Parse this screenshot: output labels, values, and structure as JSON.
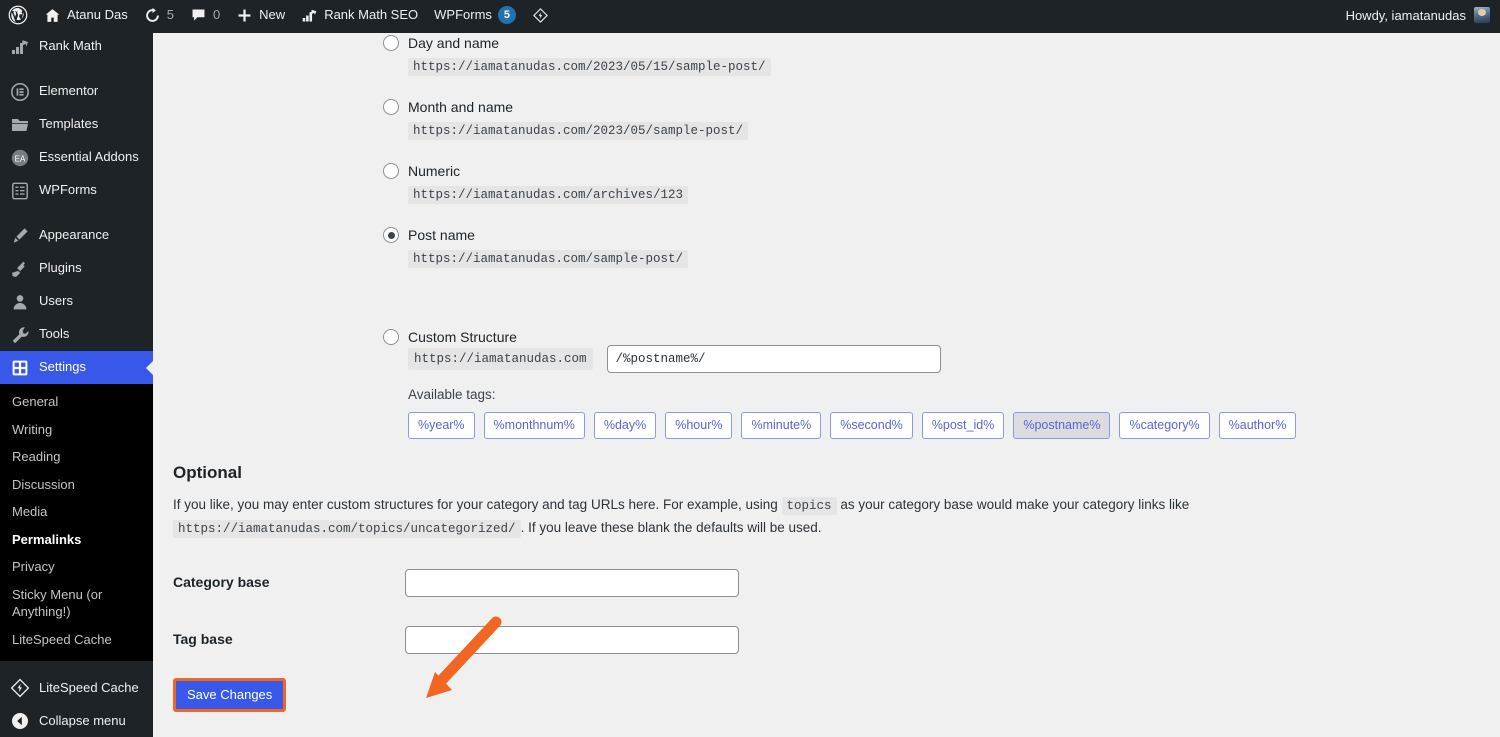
{
  "adminbar": {
    "logo_icon": "wordpress-logo-icon",
    "items": [
      {
        "icon": "home-icon",
        "label": "Atanu Das",
        "count": null
      },
      {
        "icon": "updates-icon",
        "label": "",
        "count": "5"
      },
      {
        "icon": "comment-icon",
        "label": "",
        "count": "0"
      },
      {
        "icon": "plus-icon",
        "label": "New",
        "count": null
      },
      {
        "icon": "rankmath-icon",
        "label": "Rank Math SEO",
        "count": null
      },
      {
        "icon": "wpforms-icon",
        "label": "WPForms",
        "badge": "5"
      },
      {
        "icon": "litespeed-icon",
        "label": "",
        "count": null
      }
    ],
    "howdy": "Howdy, iamatanudas"
  },
  "sidebar": {
    "menu": [
      {
        "label": "Rank Math",
        "icon": "rankmath-icon",
        "current": false,
        "gap_after": true
      },
      {
        "label": "Elementor",
        "icon": "elementor-icon",
        "current": false
      },
      {
        "label": "Templates",
        "icon": "folder-icon",
        "current": false
      },
      {
        "label": "Essential Addons",
        "icon": "essential-addons-icon",
        "current": false
      },
      {
        "label": "WPForms",
        "icon": "wpforms-icon",
        "current": false,
        "gap_after": true
      },
      {
        "label": "Appearance",
        "icon": "appearance-icon",
        "current": false
      },
      {
        "label": "Plugins",
        "icon": "plugins-icon",
        "current": false
      },
      {
        "label": "Users",
        "icon": "users-icon",
        "current": false
      },
      {
        "label": "Tools",
        "icon": "tools-icon",
        "current": false
      },
      {
        "label": "Settings",
        "icon": "settings-icon",
        "current": true
      }
    ],
    "submenu": [
      {
        "label": "General",
        "current": false
      },
      {
        "label": "Writing",
        "current": false
      },
      {
        "label": "Reading",
        "current": false
      },
      {
        "label": "Discussion",
        "current": false
      },
      {
        "label": "Media",
        "current": false
      },
      {
        "label": "Permalinks",
        "current": true
      },
      {
        "label": "Privacy",
        "current": false
      },
      {
        "label": "Sticky Menu (or Anything!)",
        "current": false
      },
      {
        "label": "LiteSpeed Cache",
        "current": false
      }
    ],
    "bottom": [
      {
        "label": "LiteSpeed Cache",
        "icon": "litespeed-icon"
      },
      {
        "label": "Collapse menu",
        "icon": "collapse-icon"
      }
    ]
  },
  "permalinks": {
    "options": [
      {
        "label": "Day and name",
        "example": "https://iamatanudas.com/2023/05/15/sample-post/",
        "selected": false
      },
      {
        "label": "Month and name",
        "example": "https://iamatanudas.com/2023/05/sample-post/",
        "selected": false
      },
      {
        "label": "Numeric",
        "example": "https://iamatanudas.com/archives/123",
        "selected": false
      },
      {
        "label": "Post name",
        "example": "https://iamatanudas.com/sample-post/",
        "selected": true
      },
      {
        "label": "Custom Structure",
        "example": "",
        "selected": false
      }
    ],
    "custom": {
      "prefix": "https://iamatanudas.com",
      "value": "/%postname%/",
      "available_tags_label": "Available tags:",
      "tags": [
        {
          "label": "%year%",
          "active": false
        },
        {
          "label": "%monthnum%",
          "active": false
        },
        {
          "label": "%day%",
          "active": false
        },
        {
          "label": "%hour%",
          "active": false
        },
        {
          "label": "%minute%",
          "active": false
        },
        {
          "label": "%second%",
          "active": false
        },
        {
          "label": "%post_id%",
          "active": false
        },
        {
          "label": "%postname%",
          "active": true
        },
        {
          "label": "%category%",
          "active": false
        },
        {
          "label": "%author%",
          "active": false
        }
      ]
    }
  },
  "optional": {
    "heading": "Optional",
    "desc_part1": "If you like, you may enter custom structures for your category and tag URLs here. For example, using",
    "desc_code1": "topics",
    "desc_part2": "as your category base would make your category links like",
    "desc_code2": "https://iamatanudas.com/topics/uncategorized/",
    "desc_part3": ". If you leave these blank the defaults will be used.",
    "category_base_label": "Category base",
    "category_base_value": "",
    "tag_base_label": "Tag base",
    "tag_base_value": ""
  },
  "actions": {
    "save_label": "Save Changes"
  },
  "colors": {
    "admin_bar": "#1d2327",
    "sidebar": "#1d2327",
    "submenu_bg": "#000000",
    "accent_blue": "#3858e9",
    "annotation_orange": "#f26522",
    "content_bg": "#f0f0f1"
  }
}
